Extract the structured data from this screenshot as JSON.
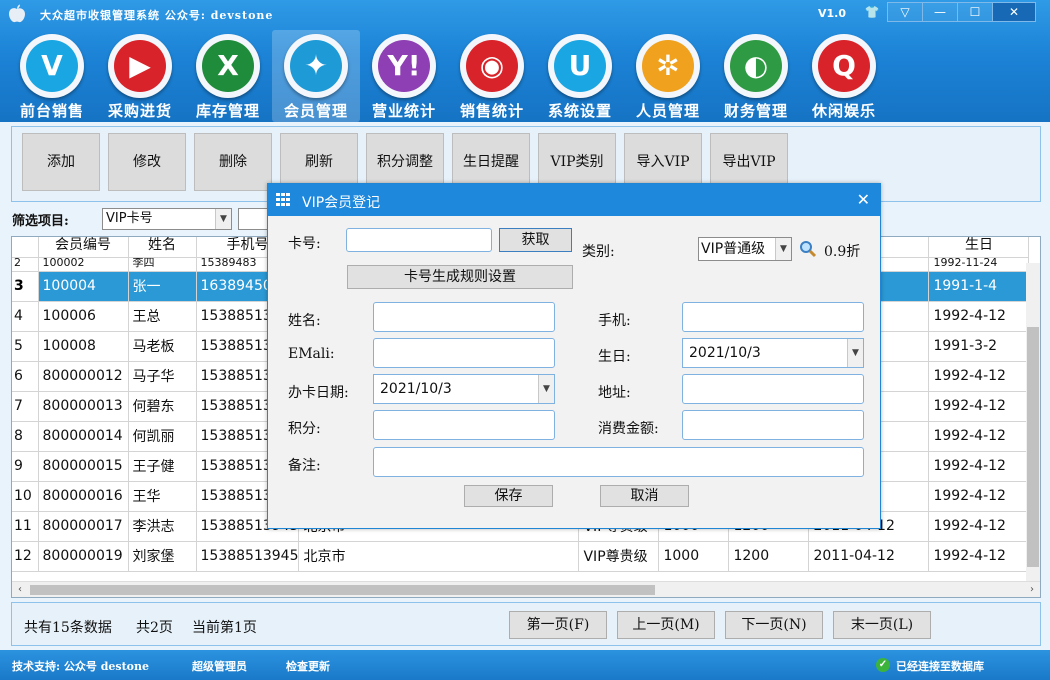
{
  "window": {
    "title": "大众超市收银管理系统  公众号: devstone",
    "version": "V1.0",
    "controls": [
      "▽",
      "—",
      "☐",
      "✕"
    ]
  },
  "nav": [
    {
      "label": "前台销售",
      "glyph": "V",
      "color": "#1aa6e2",
      "icon": "vimeo-icon"
    },
    {
      "label": "采购进货",
      "glyph": "▶",
      "color": "#d9232a",
      "icon": "youtube-icon"
    },
    {
      "label": "库存管理",
      "glyph": "X",
      "color": "#1f8c3c",
      "icon": "xing-icon"
    },
    {
      "label": "会员管理",
      "glyph": "✦",
      "color": "#1e9ad6",
      "icon": "sparkle-icon",
      "active": true
    },
    {
      "label": "营业统计",
      "glyph": "Y!",
      "color": "#8e3fb3",
      "icon": "yahoo-icon"
    },
    {
      "label": "销售统计",
      "glyph": "◉",
      "color": "#d9232a",
      "icon": "weibo-icon"
    },
    {
      "label": "系统设置",
      "glyph": "U",
      "color": "#1aa6e2",
      "icon": "u-icon"
    },
    {
      "label": "人员管理",
      "glyph": "✲",
      "color": "#f0a11e",
      "icon": "people-icon"
    },
    {
      "label": "财务管理",
      "glyph": "◐",
      "color": "#2f9a44",
      "icon": "finance-icon"
    },
    {
      "label": "休闲娱乐",
      "glyph": "Q",
      "color": "#d9232a",
      "icon": "quora-icon"
    }
  ],
  "toolbar": [
    "添加",
    "修改",
    "删除",
    "刷新",
    "积分调整",
    "生日提醒",
    "VIP类别",
    "导入VIP",
    "导出VIP"
  ],
  "filter": {
    "label": "筛选项目:",
    "value": "VIP卡号"
  },
  "grid": {
    "headers": [
      "",
      "会员编号",
      "姓名",
      "手机号",
      "",
      "",
      "",
      "",
      "期",
      "生日"
    ],
    "partial_row": [
      "2",
      "100002",
      "李四",
      "15389483",
      "",
      "",
      "",
      "",
      "0",
      "1992-11-24"
    ],
    "rows": [
      {
        "n": "3",
        "id": "100004",
        "name": "张一",
        "phone": "16389450",
        "addr": "",
        "type": "",
        "pts": "",
        "amt": "",
        "date": "20",
        "bday": "1991-1-4",
        "sel": true
      },
      {
        "n": "4",
        "id": "100006",
        "name": "王总",
        "phone": "15388513",
        "addr": "",
        "type": "",
        "pts": "",
        "amt": "",
        "date": "2",
        "bday": "1992-4-12"
      },
      {
        "n": "5",
        "id": "100008",
        "name": "马老板",
        "phone": "15388513",
        "addr": "",
        "type": "",
        "pts": "",
        "amt": "",
        "date": "20",
        "bday": "1991-3-2"
      },
      {
        "n": "6",
        "id": "800000012",
        "name": "马子华",
        "phone": "15388513",
        "addr": "",
        "type": "",
        "pts": "",
        "amt": "",
        "date": "2",
        "bday": "1992-4-12"
      },
      {
        "n": "7",
        "id": "800000013",
        "name": "何碧东",
        "phone": "15388513",
        "addr": "",
        "type": "",
        "pts": "",
        "amt": "",
        "date": "2",
        "bday": "1992-4-12"
      },
      {
        "n": "8",
        "id": "800000014",
        "name": "何凯丽",
        "phone": "15388513",
        "addr": "",
        "type": "",
        "pts": "",
        "amt": "",
        "date": "2",
        "bday": "1992-4-12"
      },
      {
        "n": "9",
        "id": "800000015",
        "name": "王子健",
        "phone": "15388513",
        "addr": "",
        "type": "",
        "pts": "",
        "amt": "",
        "date": "2",
        "bday": "1992-4-12"
      },
      {
        "n": "10",
        "id": "800000016",
        "name": "王华",
        "phone": "15388513",
        "addr": "",
        "type": "",
        "pts": "",
        "amt": "",
        "date": "2",
        "bday": "1992-4-12"
      },
      {
        "n": "11",
        "id": "800000017",
        "name": "李洪志",
        "phone": "15388513945",
        "addr": "北京市",
        "type": "VIP尊贵级",
        "pts": "1000",
        "amt": "1200",
        "date": "2011-04-12",
        "bday": "1992-4-12"
      },
      {
        "n": "12",
        "id": "800000019",
        "name": "刘家堡",
        "phone": "15388513945",
        "addr": "北京市",
        "type": "VIP尊贵级",
        "pts": "1000",
        "amt": "1200",
        "date": "2011-04-12",
        "bday": "1992-4-12"
      }
    ]
  },
  "footer": {
    "total": "共有15条数据",
    "pages": "共2页",
    "current": "当前第1页",
    "first": "第一页(F)",
    "prev": "上一页(M)",
    "next": "下一页(N)",
    "last": "末一页(L)"
  },
  "status": {
    "support": "技术支持: 公众号 destone",
    "user": "超级管理员",
    "update": "检查更新",
    "db": "已经连接至数据库"
  },
  "dialog": {
    "title": "VIP会员登记",
    "card_label": "卡号:",
    "card_value": "",
    "fetch_btn": "获取",
    "rule_btn": "卡号生成规则设置",
    "type_label": "类别:",
    "type_value": "VIP普通级",
    "discount": "0.9折",
    "name_label": "姓名:",
    "name_value": "",
    "phone_label": "手机:",
    "phone_value": "",
    "email_label": "EMali:",
    "email_value": "",
    "birthday_label": "生日:",
    "birthday_value": "2021/10/3",
    "issue_label": "办卡日期:",
    "issue_value": "2021/10/3",
    "address_label": "地址:",
    "address_value": "",
    "points_label": "积分:",
    "points_value": "",
    "spend_label": "消费金额:",
    "spend_value": "",
    "note_label": "备注:",
    "note_value": "",
    "save_btn": "保存",
    "cancel_btn": "取消"
  }
}
